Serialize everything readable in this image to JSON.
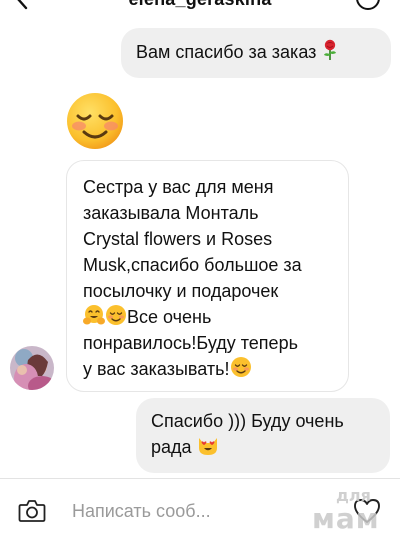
{
  "header": {
    "title": "elena_geraskina",
    "back_icon": "chevron-left-icon",
    "info_icon": "info-circle-icon"
  },
  "messages": [
    {
      "direction": "outgoing",
      "text": "Вам спасибо за заказ",
      "emoji": "rose"
    },
    {
      "direction": "incoming",
      "type": "emoji-only",
      "emoji": "smiling-face-with-blushed-eyes"
    },
    {
      "direction": "incoming",
      "lines": [
        "Сестра у вас для меня",
        "заказывала Монталь",
        "Crystal flowers и Roses",
        "Musk,спасибо большое за",
        "посылочку и подарочек",
        "Все очень",
        "понравилось!Буду теперь",
        "у вас заказывать!"
      ],
      "inline_emojis": [
        "hugging-face",
        "smiling-face",
        "smiling-face"
      ]
    },
    {
      "direction": "outgoing",
      "lines": [
        "Спасибо ))) Буду очень",
        "рада"
      ],
      "emoji": "smiling-cat-heart-eyes"
    }
  ],
  "composer": {
    "placeholder": "Написать сооб...",
    "camera_icon": "camera-icon",
    "heart_icon": "heart-icon"
  },
  "watermark": {
    "top": "для",
    "bottom": "мам"
  },
  "colors": {
    "outgoing_bubble": "#efefef",
    "incoming_border": "#e6e6e6",
    "placeholder": "#9a9a9a"
  }
}
